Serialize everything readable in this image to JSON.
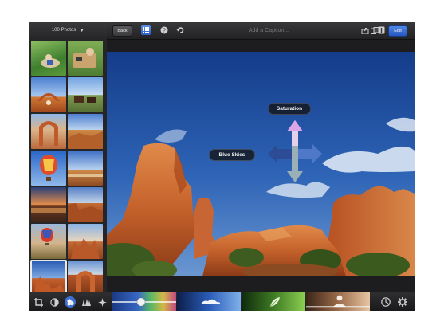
{
  "sidebar": {
    "photo_count_label": "100 Photos",
    "dropdown_icon": "triangle-down-icon",
    "thumbnails": [
      "picnic",
      "camper",
      "arch-sunset",
      "horses",
      "delicate-arch",
      "desert-road",
      "balloon-sky",
      "canyon-mesa",
      "lake-sunset",
      "red-cliffs",
      "balloon-valley",
      "sandstone-fins",
      "blue-sky-rocks",
      "arch-rock"
    ]
  },
  "toolbar": {
    "back_label": "Back",
    "caption_placeholder": "Add a Caption...",
    "edit_label": "Edit",
    "left_icons": [
      "grid-icon",
      "info-icon",
      "undo-icon"
    ],
    "right_icons": [
      "share-icon",
      "info-panel-icon",
      "compare-icon"
    ]
  },
  "overlay": {
    "saturation_label": "Saturation",
    "blue_skies_label": "Blue Skies"
  },
  "bottom_tools": [
    "crop-icon",
    "exposure-icon",
    "color-icon",
    "brushes-icon",
    "effects-icon"
  ],
  "bottom_right_icons": [
    "auto-enhance-icon",
    "settings-icon"
  ],
  "colors": {
    "accent": "#2f63d3",
    "toolbar": "#2a2a2d",
    "sky": "#2e5fae",
    "rock": "#c4612b"
  }
}
